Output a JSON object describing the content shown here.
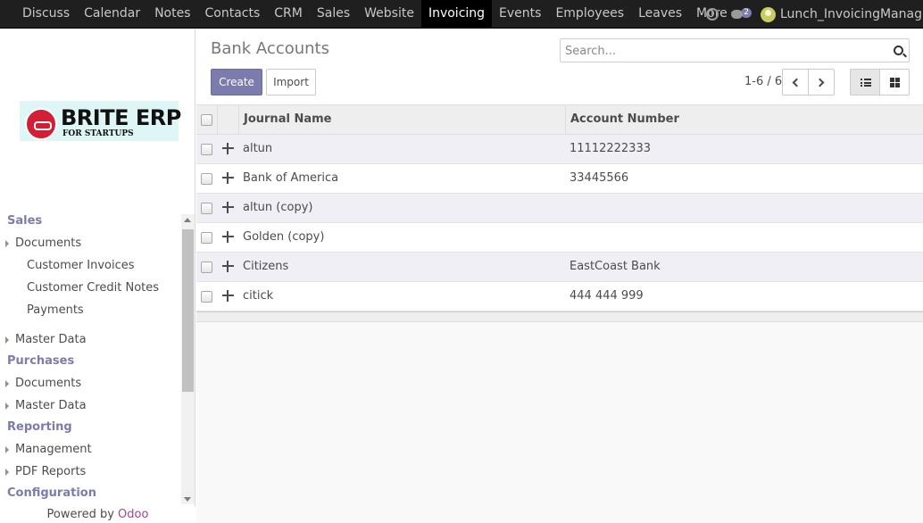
{
  "topbar": {
    "menu": [
      "Discuss",
      "Calendar",
      "Notes",
      "Contacts",
      "CRM",
      "Sales",
      "Website",
      "Invoicing",
      "Events",
      "Employees",
      "Leaves",
      "More"
    ],
    "active": "Invoicing",
    "chat_count": "2",
    "user": "Lunch_InvoicingManag..."
  },
  "sidebar": {
    "logo_title": "BRITE ERP",
    "logo_subtitle": "FOR STARTUPS",
    "sections": {
      "sales": {
        "title": "Sales",
        "documents": "Documents",
        "customer_invoices": "Customer Invoices",
        "customer_credit_notes": "Customer Credit Notes",
        "payments": "Payments",
        "master_data": "Master Data"
      },
      "purchases": {
        "title": "Purchases",
        "documents": "Documents",
        "master_data": "Master Data"
      },
      "reporting": {
        "title": "Reporting",
        "management": "Management",
        "pdf_reports": "PDF Reports"
      },
      "configuration": {
        "title": "Configuration"
      }
    },
    "powered_by": "Powered by",
    "powered_brand": "Odoo"
  },
  "control_panel": {
    "title": "Bank Accounts",
    "create_label": "Create",
    "import_label": "Import",
    "search_placeholder": "Search...",
    "pager": "1-6 / 6"
  },
  "table": {
    "headers": [
      "Journal Name",
      "Account Number"
    ],
    "rows": [
      {
        "name": "altun",
        "account": "11112222333"
      },
      {
        "name": "Bank of America",
        "account": "33445566"
      },
      {
        "name": "altun (copy)",
        "account": ""
      },
      {
        "name": "Golden (copy)",
        "account": ""
      },
      {
        "name": "Citizens",
        "account": "EastCoast Bank"
      },
      {
        "name": "citick",
        "account": "444 444 999"
      }
    ]
  },
  "colors": {
    "accent": "#7c7bad",
    "topbar": "#1f1f1f",
    "odd_row": "#efeff5",
    "brand_odoo": "#a24689"
  }
}
